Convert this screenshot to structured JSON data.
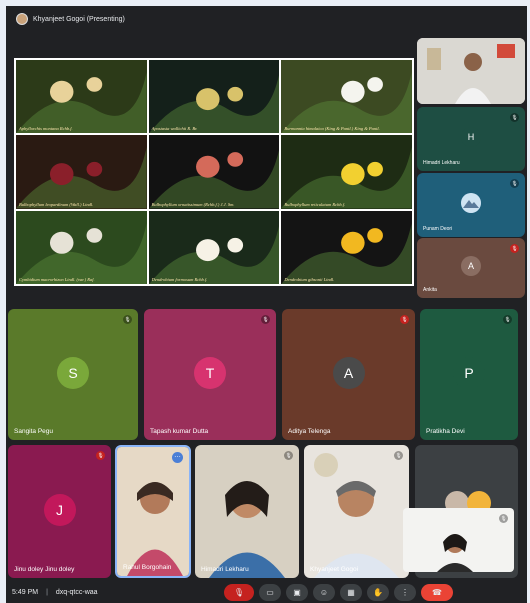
{
  "presenter": {
    "label": "Khyanjeet Gogoi (Presenting)"
  },
  "slide": {
    "captions": [
      "Aphyllorchis montana Rchb.f.",
      "Apostasia wallichii R. Br.",
      "Burmannia himalaica (King & Pantl.) King & Pantl.",
      "Bulbophyllum leopardinum (Wall.) Lindl.",
      "Bulbophyllum ornatissimum (Rchb.f.) J.J. Sm.",
      "Bulbophyllum reticulatum Rchb.f.",
      "Cymbidium macrorhizon Lindl. (var.) Raf.",
      "Dendrobium formosum Rchb.f.",
      "Dendrobium gibsonii Lindl."
    ],
    "colors": [
      "#2c3a18",
      "#14201a",
      "#3c4a22",
      "#2a1a12",
      "#121212",
      "#1e2c14",
      "#2c4a1e",
      "#1a2a1a",
      "#141414"
    ]
  },
  "participants_side": [
    {
      "name": "",
      "type": "video"
    },
    {
      "name": "Himadri Lekharu",
      "initial": "H",
      "bg": "#1e4e43",
      "avatar": "#1e4e43"
    },
    {
      "name": "Punam Deori",
      "initial": "",
      "bg": "#1f5f7a",
      "avatar": "#3b7fb0"
    },
    {
      "name": "Ankita",
      "initial": "A",
      "bg": "#6a4a3f",
      "avatar": "#8a6d62"
    }
  ],
  "participants_mid": [
    {
      "name": "Sangita Pegu",
      "initial": "S",
      "bg": "#5a7a2a",
      "avatar": "#7aa83a"
    },
    {
      "name": "Tapash kumar Dutta",
      "initial": "T",
      "bg": "#9a2f5a",
      "avatar": "#d7336f"
    },
    {
      "name": "Aditya Telenga",
      "initial": "A",
      "bg": "#6a3a2a",
      "avatar": "#4a4a4a"
    },
    {
      "name": "Pratikha Devi",
      "initial": "P",
      "bg": "#1e5a40",
      "avatar": "#1e5a40"
    }
  ],
  "participants_bottom": [
    {
      "name": "Jinu doley Jinu doley",
      "initial": "J",
      "bg": "#8a1a50",
      "avatar": "#c2185b"
    },
    {
      "name": "Rahul Borgohain",
      "type": "video"
    },
    {
      "name": "Himadri Lekharu",
      "type": "video"
    },
    {
      "name": "Khyanjeet Gogoi",
      "type": "video"
    }
  ],
  "footer": {
    "time": "5:49 PM",
    "separator": "|",
    "meeting_code": "dxq-qtcc-waa"
  },
  "controls": [
    {
      "name": "mic-button",
      "icon": "mic-off-icon",
      "glyph": "🎙"
    },
    {
      "name": "camera-button",
      "icon": "camera-icon",
      "glyph": "▭"
    },
    {
      "name": "captions-button",
      "icon": "captions-icon",
      "glyph": "▣"
    },
    {
      "name": "emoji-button",
      "icon": "emoji-icon",
      "glyph": "☺"
    },
    {
      "name": "present-button",
      "icon": "present-icon",
      "glyph": "▦"
    },
    {
      "name": "raise-hand-button",
      "icon": "hand-icon",
      "glyph": "✋"
    },
    {
      "name": "more-options-button",
      "icon": "more-vert-icon",
      "glyph": "⋮"
    },
    {
      "name": "end-call-button",
      "icon": "phone-hangup-icon",
      "glyph": "☎"
    }
  ]
}
